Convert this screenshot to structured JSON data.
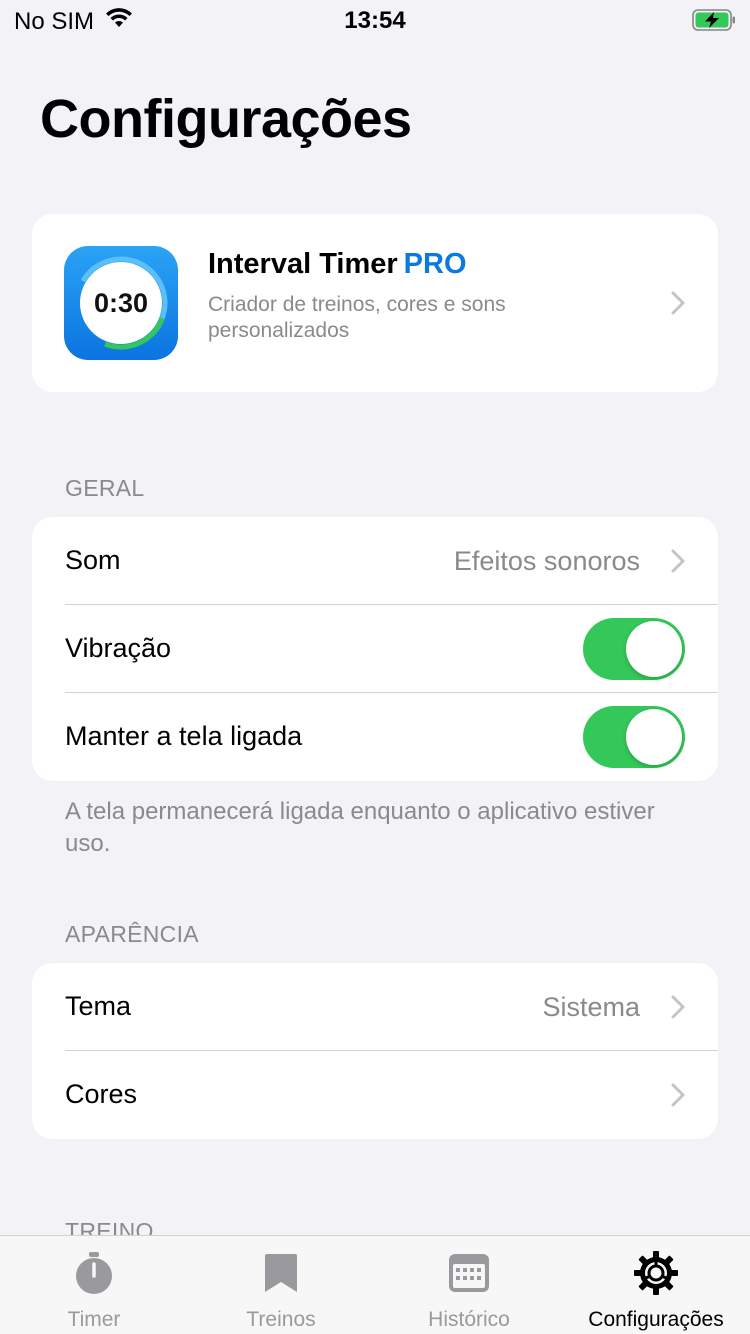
{
  "status_bar": {
    "carrier": "No SIM",
    "time": "13:54"
  },
  "page_title": "Configurações",
  "pro_card": {
    "icon_time": "0:30",
    "title": "Interval Timer",
    "badge": "PRO",
    "subtitle": "Criador de treinos, cores e sons personalizados"
  },
  "general": {
    "header": "GERAL",
    "sound_label": "Som",
    "sound_value": "Efeitos sonoros",
    "vibration_label": "Vibração",
    "vibration_on": true,
    "keep_screen_label": "Manter a tela ligada",
    "keep_screen_on": true,
    "footnote": "A tela permanecerá ligada enquanto o aplicativo estiver uso."
  },
  "appearance": {
    "header": "APARÊNCIA",
    "theme_label": "Tema",
    "theme_value": "Sistema",
    "colors_label": "Cores"
  },
  "next_section_header": "TREINO",
  "tabs": [
    {
      "label": "Timer",
      "icon": "stopwatch-icon",
      "active": false
    },
    {
      "label": "Treinos",
      "icon": "bookmark-icon",
      "active": false
    },
    {
      "label": "Histórico",
      "icon": "calendar-icon",
      "active": false
    },
    {
      "label": "Configurações",
      "icon": "gear-icon",
      "active": true
    }
  ],
  "colors": {
    "accent": "#0a7ae0",
    "toggle_on": "#34c759",
    "background": "#f2f2f7",
    "secondary_text": "#8a8a8e"
  }
}
